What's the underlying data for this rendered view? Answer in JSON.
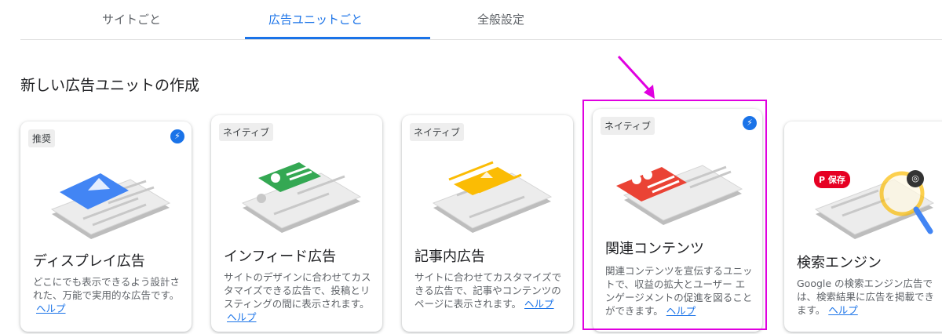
{
  "tabs": {
    "site": "サイトごと",
    "adunit": "広告ユニットごと",
    "general": "全般設定"
  },
  "section_title": "新しい広告ユニットの作成",
  "help_label": "ヘルプ",
  "cards": [
    {
      "badge": "推奨",
      "title": "ディスプレイ広告",
      "desc": "どこにでも表示できるよう設計された、万能で実用的な広告です。",
      "accent": "#4285f4"
    },
    {
      "badge": "ネイティブ",
      "title": "インフィード広告",
      "desc": "サイトのデザインに合わせてカスタマイズできる広告で、投稿とリスティングの間に表示されます。",
      "accent": "#34a853"
    },
    {
      "badge": "ネイティブ",
      "title": "記事内広告",
      "desc": "サイトに合わせてカスタマイズできる広告で、記事やコンテンツのページに表示されます。",
      "accent": "#fbbc04"
    },
    {
      "badge": "ネイティブ",
      "title": "関連コンテンツ",
      "desc": "関連コンテンツを宣伝するユニットで、収益の拡大とユーザー エンゲージメントの促進を図ることができます。",
      "accent": "#ea4335"
    },
    {
      "badge": "",
      "title": "検索エンジン",
      "desc": "Google の検索エンジン広告では、検索結果に広告を掲載できます。",
      "accent": "#fbbc04"
    }
  ],
  "pin_label": "保存",
  "annotation_color": "#e000e0"
}
